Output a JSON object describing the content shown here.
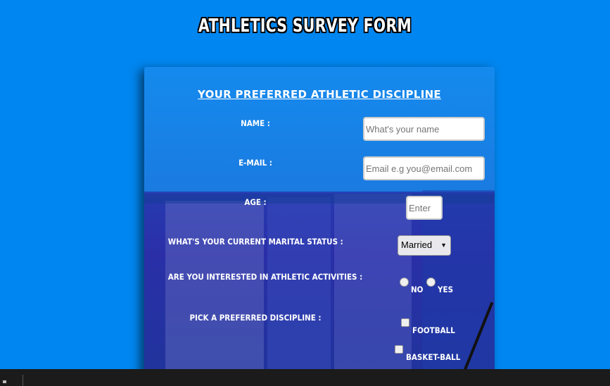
{
  "page": {
    "title": "Athletics Survey Form"
  },
  "form": {
    "section_title": "Your Preferred Athletic Discipline",
    "name": {
      "label": "Name :",
      "placeholder": "What's your name"
    },
    "email": {
      "label": "E-mail :",
      "placeholder": "Email e.g you@email.com"
    },
    "age": {
      "label": "Age :",
      "placeholder": "Enter"
    },
    "marital": {
      "label": "What's your current marital status :",
      "selected": "Married"
    },
    "interest": {
      "label": "Are you interested in athletic activities :",
      "options": [
        "No",
        "Yes"
      ]
    },
    "discipline": {
      "label": "Pick a preferred discipline :",
      "options": [
        "Football",
        "Basket-ball"
      ]
    }
  }
}
